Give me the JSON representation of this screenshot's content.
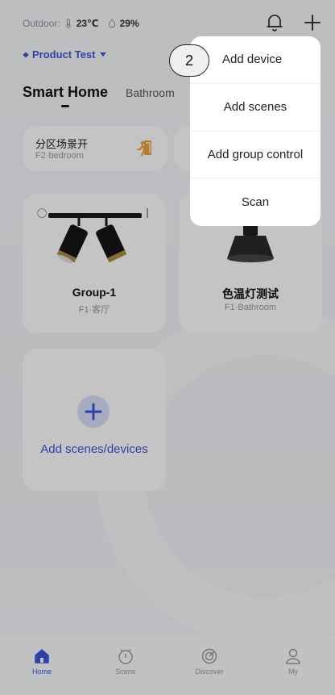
{
  "header": {
    "outdoor_label": "Outdoor:",
    "temperature": "23℃",
    "humidity": "29%",
    "product_name": "Product Test"
  },
  "home": {
    "title": "Smart Home",
    "tab_bathroom": "Bathroom"
  },
  "scene_cards": [
    {
      "name": "分区场景开",
      "room": "F2·bedroom"
    }
  ],
  "devices": [
    {
      "name": "Group-1",
      "room": "F1·客厅"
    },
    {
      "name": "色温灯测试",
      "room": "F1·Bathroom"
    }
  ],
  "add_card": {
    "label": "Add scenes/devices"
  },
  "menu": {
    "items": [
      "Add device",
      "Add scenes",
      "Add group control",
      "Scan"
    ]
  },
  "step_marker": "2",
  "bottom_nav": {
    "items": [
      {
        "label": "Home",
        "icon": "home-icon"
      },
      {
        "label": "Scene",
        "icon": "scene-icon"
      },
      {
        "label": "Discover",
        "icon": "discover-icon"
      },
      {
        "label": "My",
        "icon": "profile-icon"
      }
    ]
  },
  "colors": {
    "accent": "#3c54d8",
    "overlay": "rgba(0,0,0,0.22)"
  }
}
